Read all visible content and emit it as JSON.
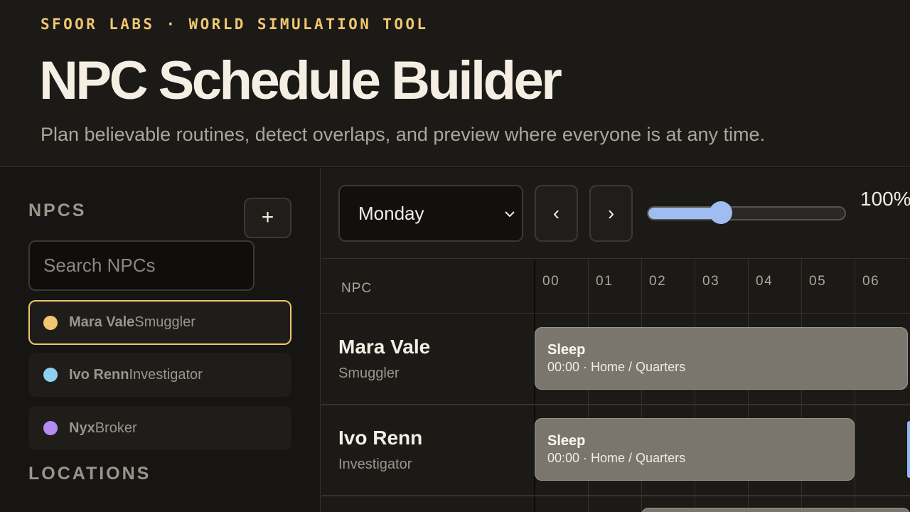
{
  "header": {
    "eyebrow": "SFOOR LABS · WORLD SIMULATION TOOL",
    "title": "NPC Schedule Builder",
    "subtitle": "Plan believable routines, detect overlaps, and preview where everyone is at any time."
  },
  "sidebar": {
    "npcs_heading": "NPCS",
    "add_label": "+",
    "search_placeholder": "Search NPCs",
    "npcs": [
      {
        "name": "Mara Vale",
        "role": "Smuggler",
        "color": "#f1c66e",
        "selected": true
      },
      {
        "name": "Ivo Renn",
        "role": "Investigator",
        "color": "#8fd0f0",
        "selected": false
      },
      {
        "name": "Nyx",
        "role": "Broker",
        "color": "#b48cf0",
        "selected": false
      }
    ],
    "locations_heading": "LOCATIONS"
  },
  "controls": {
    "day": "Monday",
    "prev_label": "‹",
    "next_label": "›",
    "zoom_percent": 100,
    "zoom_label": "100%",
    "zoom_slider_fraction": 0.37
  },
  "grid": {
    "npc_column_label": "NPC",
    "hours": [
      "00",
      "01",
      "02",
      "03",
      "04",
      "05",
      "06"
    ],
    "rows": [
      {
        "name": "Mara Vale",
        "role": "Smuggler",
        "block_title": "Sleep",
        "block_detail": "00:00 · Home / Quarters"
      },
      {
        "name": "Ivo Renn",
        "role": "Investigator",
        "block_title": "Sleep",
        "block_detail": "00:00 · Home / Quarters"
      }
    ]
  }
}
